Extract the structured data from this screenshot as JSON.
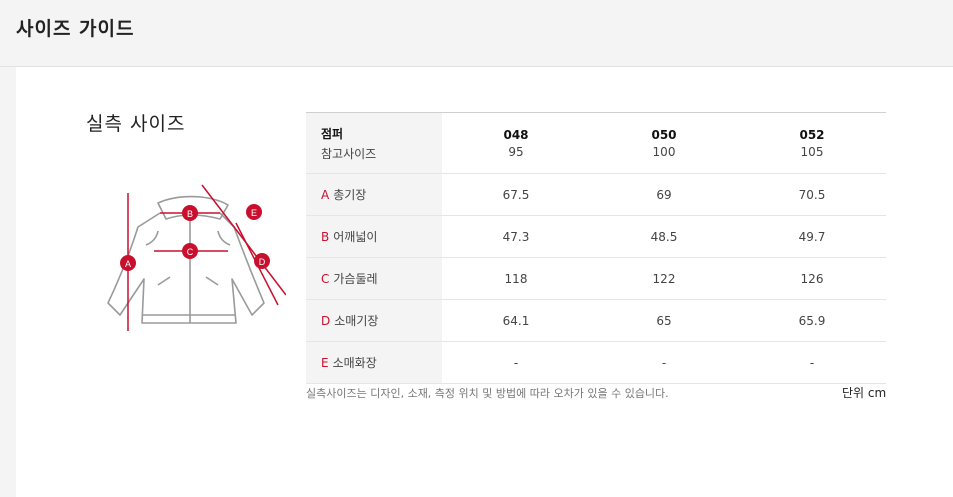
{
  "header": {
    "title": "사이즈 가이드"
  },
  "section": {
    "title": "실측 사이즈"
  },
  "diagram": {
    "markers": [
      "A",
      "B",
      "C",
      "D",
      "E"
    ],
    "accent_color": "#c8102e"
  },
  "table": {
    "header": {
      "main": "점퍼",
      "sub": "참고사이즈"
    },
    "columns": [
      {
        "size": "048",
        "ref": "95"
      },
      {
        "size": "050",
        "ref": "100"
      },
      {
        "size": "052",
        "ref": "105"
      }
    ],
    "rows": [
      {
        "letter": "A",
        "label": "총기장",
        "values": [
          "67.5",
          "69",
          "70.5"
        ]
      },
      {
        "letter": "B",
        "label": "어깨넓이",
        "values": [
          "47.3",
          "48.5",
          "49.7"
        ]
      },
      {
        "letter": "C",
        "label": "가슴둘레",
        "values": [
          "118",
          "122",
          "126"
        ]
      },
      {
        "letter": "D",
        "label": "소매기장",
        "values": [
          "64.1",
          "65",
          "65.9"
        ]
      },
      {
        "letter": "E",
        "label": "소매화장",
        "values": [
          "-",
          "-",
          "-"
        ]
      }
    ]
  },
  "footer": {
    "note": "실측사이즈는 디자인, 소재, 측정 위치 및 방법에 따라 오차가 있을 수 있습니다.",
    "unit": "단위 cm"
  }
}
